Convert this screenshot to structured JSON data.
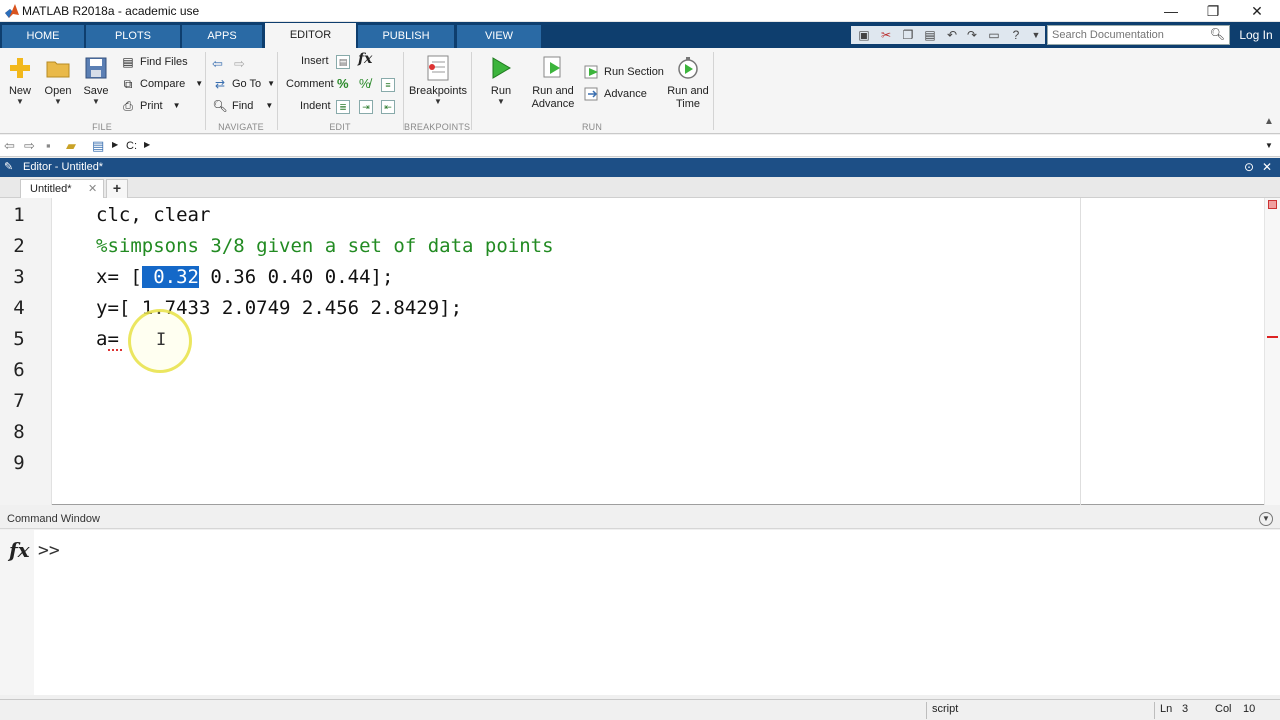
{
  "window": {
    "title": "MATLAB R2018a - academic use",
    "minimize": "—",
    "maximize": "❐",
    "close": "✕"
  },
  "tabs": [
    "HOME",
    "PLOTS",
    "APPS",
    "EDITOR",
    "PUBLISH",
    "VIEW"
  ],
  "active_tab": "EDITOR",
  "search": {
    "placeholder": "Search Documentation"
  },
  "login_label": "Log In",
  "ribbon": {
    "file": {
      "label": "FILE",
      "new": "New",
      "open": "Open",
      "save": "Save",
      "find_files": "Find Files",
      "compare": "Compare",
      "print": "Print"
    },
    "navigate": {
      "label": "NAVIGATE",
      "go_to": "Go To",
      "find": "Find"
    },
    "edit": {
      "label": "EDIT",
      "insert": "Insert",
      "comment": "Comment",
      "indent": "Indent",
      "fx": "fx"
    },
    "breakpoints": {
      "label": "BREAKPOINTS",
      "breakpoints": "Breakpoints"
    },
    "run": {
      "label": "RUN",
      "run": "Run",
      "run_and_advance_1": "Run and",
      "run_and_advance_2": "Advance",
      "run_section": "Run Section",
      "advance": "Advance",
      "run_and_time_1": "Run and",
      "run_and_time_2": "Time"
    }
  },
  "address": {
    "path": "C:"
  },
  "editor": {
    "title": "Editor - Untitled*",
    "file_tab": "Untitled*",
    "line_numbers": [
      "1",
      "2",
      "3",
      "4",
      "5",
      "6",
      "7",
      "8",
      "9"
    ],
    "lines": {
      "l1": "clc, clear",
      "l2": "%simpsons 3/8 given a set of data points",
      "l3_pre": "x= [",
      "l3_sel": " 0.32",
      "l3_post": " 0.36 0.40 0.44];",
      "l4": "y=[ 1.7433 2.0749 2.456 2.8429];",
      "l5": "a="
    }
  },
  "command_window": {
    "title": "Command Window",
    "fx": "fx",
    "prompt": ">>"
  },
  "status": {
    "mode": "script",
    "ln_label": "Ln",
    "ln_value": "3",
    "col_label": "Col",
    "col_value": "10"
  }
}
